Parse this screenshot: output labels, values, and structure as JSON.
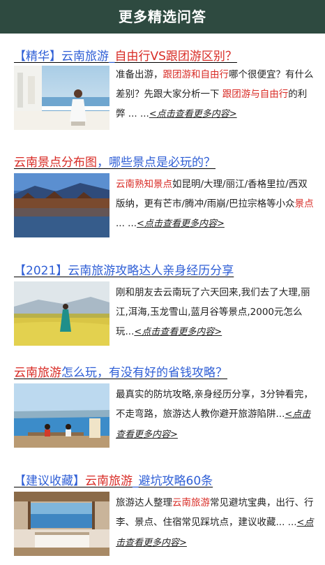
{
  "header": {
    "title": "更多精选问答"
  },
  "more_label": "<点击查看更多内容>",
  "items": [
    {
      "title_parts": [
        {
          "text": "【精华】云南旅游_",
          "color": "blue"
        },
        {
          "text": "自由行VS跟团游区别？",
          "color": "red"
        }
      ],
      "desc_parts": [
        {
          "text": "准备出游，",
          "color": "normal"
        },
        {
          "text": "跟团游和自由行",
          "color": "red"
        },
        {
          "text": "哪个很便宜？有什么差别？先跟大家分析一下 ",
          "color": "normal"
        },
        {
          "text": "跟团游与自由行",
          "color": "red"
        },
        {
          "text": "的利弊 ... ...",
          "color": "normal"
        }
      ],
      "image": "woman-on-terrace-by-lake"
    },
    {
      "title_parts": [
        {
          "text": "云南景点分布图",
          "color": "red"
        },
        {
          "text": "，哪些景点是必玩的？",
          "color": "blue"
        }
      ],
      "desc_parts": [
        {
          "text": "云南熟知景点",
          "color": "red"
        },
        {
          "text": "如昆明/大理/丽江/香格里拉/西双版纳，更有芒市/腾冲/雨崩/巴拉宗格等小众",
          "color": "normal"
        },
        {
          "text": "景点",
          "color": "red"
        },
        {
          "text": " ... ...",
          "color": "normal"
        }
      ],
      "image": "old-town-reflection-lake"
    },
    {
      "title_parts": [
        {
          "text": "【2021】云南旅游攻略",
          "color": "blue"
        },
        {
          "text": "达人亲身经历分享",
          "color": "blue"
        }
      ],
      "desc_parts": [
        {
          "text": "刚和朋友去云南玩了六天回来,我们去了大理,丽江,洱海,玉龙雪山,蓝月谷等景点,2000元怎么玩...",
          "color": "normal"
        }
      ],
      "image": "woman-in-yellow-flower-field"
    },
    {
      "title_parts": [
        {
          "text": "云南旅游",
          "color": "red"
        },
        {
          "text": "怎么玩，有没有好的省钱攻略？",
          "color": "blue"
        }
      ],
      "desc_parts": [
        {
          "text": "最真实的防坑攻略,亲身经历分享，3分钟看完，不走弯路，旅游达人教你避开旅游陷阱...",
          "color": "normal"
        }
      ],
      "image": "people-by-lake-shore"
    },
    {
      "title_parts": [
        {
          "text": "【建议收藏】",
          "color": "blue"
        },
        {
          "text": "云南旅游",
          "color": "red"
        },
        {
          "text": "_避坑攻略60条",
          "color": "blue"
        }
      ],
      "desc_parts": [
        {
          "text": "旅游达人整理",
          "color": "normal"
        },
        {
          "text": "云南旅游",
          "color": "red"
        },
        {
          "text": "常见避坑宝典，出行、行李、景点、住宿常见踩坑点，建议收藏... ...",
          "color": "normal"
        }
      ],
      "image": "hotel-room-lake-view"
    }
  ]
}
